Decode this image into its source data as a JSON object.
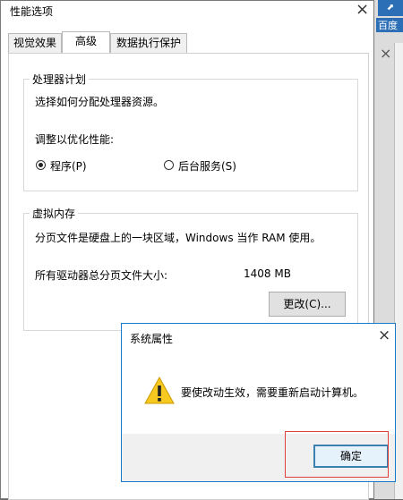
{
  "background": {
    "taskbar_label": "百度",
    "right_panel_close": "×"
  },
  "main_window": {
    "title": "性能选项",
    "tabs": [
      {
        "label": "视觉效果",
        "active": false
      },
      {
        "label": "高级",
        "active": true
      },
      {
        "label": "数据执行保护",
        "active": false
      }
    ],
    "processor_group": {
      "title": "处理器计划",
      "description": "选择如何分配处理器资源。",
      "adjust_label": "调整以优化性能:",
      "options": [
        {
          "label": "程序(P)",
          "checked": true
        },
        {
          "label": "后台服务(S)",
          "checked": false
        }
      ]
    },
    "virtual_memory_group": {
      "title": "虚拟内存",
      "description": "分页文件是硬盘上的一块区域，Windows 当作 RAM 使用。",
      "total_label": "所有驱动器总分页文件大小:",
      "total_value": "1408 MB",
      "change_button": "更改(C)..."
    }
  },
  "dialog": {
    "title": "系统属性",
    "message": "要使改动生效，需要重新启动计算机。",
    "ok_button": "确定",
    "icon": "warning-icon"
  },
  "colors": {
    "dialog_border": "#1979ca",
    "highlight_box": "#e0403a",
    "warning_fill": "#f7c81f"
  }
}
